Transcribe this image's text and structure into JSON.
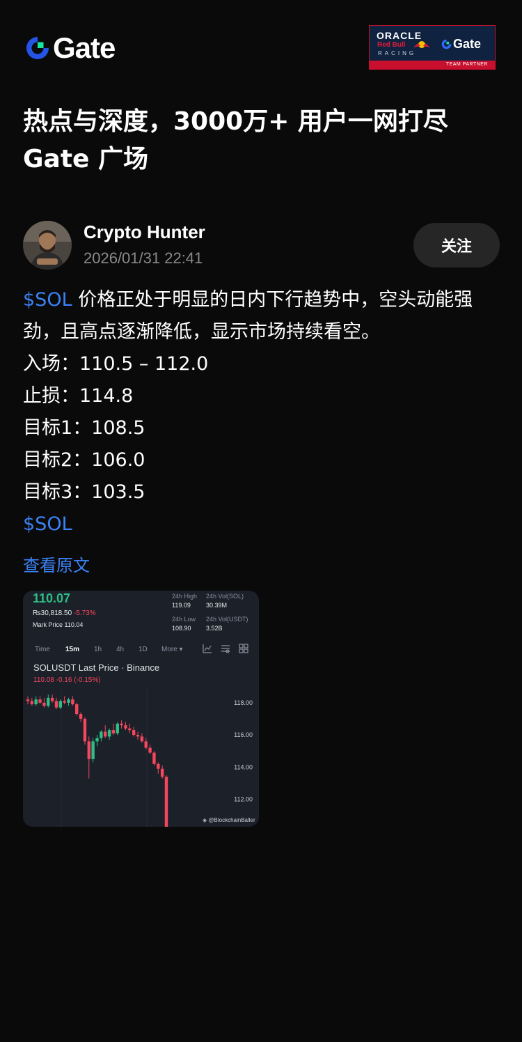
{
  "header": {
    "logo_text": "Gate",
    "partner": {
      "oracle": "ORACLE",
      "redbull": "Red Bull",
      "racing": "RACING",
      "gate": "Gate",
      "label": "TEAM PARTNER"
    }
  },
  "headline": {
    "line1": "热点与深度，3000万+ 用户一网打尽",
    "line2": "Gate 广场"
  },
  "author": {
    "name": "Crypto Hunter",
    "time": "2026/01/31 22:41",
    "follow_label": "关注"
  },
  "post": {
    "tag": "$SOL",
    "intro": " 价格正处于明显的日内下行趋势中，空头动能强劲，且高点逐渐降低，显示市场持续看空。",
    "lines": [
      "入场：110.5 – 112.0",
      "止损：114.8",
      "目标1：108.5",
      "目标2：106.0",
      "目标3：103.5"
    ],
    "tag_end": "$SOL",
    "view_original": "查看原文"
  },
  "trade_card": {
    "price": "110.07",
    "inr": "₨30,818.50",
    "change": "-5.73%",
    "mark_price": "Mark Price 110.04",
    "stats": [
      {
        "label": "24h High",
        "value": "119.09"
      },
      {
        "label": "24h Vol(SOL)",
        "value": "30.39M"
      },
      {
        "label": "24h Low",
        "value": "108.90"
      },
      {
        "label": "24h Vol(USDT)",
        "value": "3.52B"
      }
    ],
    "timeframes": [
      "Time",
      "15m",
      "1h",
      "4h",
      "1D",
      "More ▾"
    ],
    "active_timeframe": "15m",
    "chart_title": "SOLUSDT Last Price · Binance",
    "last_line": "110.08 -0.16 (-0.15%)",
    "watermark": "@BlockchainBaller",
    "colors": {
      "up": "#2ebd85",
      "down": "#f6465d",
      "bg": "#1b2029"
    }
  },
  "chart_data": {
    "type": "candlestick",
    "title": "SOLUSDT Last Price · Binance",
    "y_ticks": [
      "118.00",
      "116.00",
      "114.00",
      "112.00"
    ],
    "ylim": [
      110.3,
      118.9
    ],
    "candles": [
      {
        "o": 118.2,
        "h": 118.4,
        "l": 117.9,
        "c": 118.1
      },
      {
        "o": 118.1,
        "h": 118.3,
        "l": 117.8,
        "c": 117.9
      },
      {
        "o": 117.9,
        "h": 118.4,
        "l": 117.8,
        "c": 118.2
      },
      {
        "o": 118.2,
        "h": 118.4,
        "l": 117.9,
        "c": 118.0
      },
      {
        "o": 118.0,
        "h": 118.3,
        "l": 117.7,
        "c": 117.8
      },
      {
        "o": 117.8,
        "h": 118.5,
        "l": 117.7,
        "c": 118.3
      },
      {
        "o": 118.3,
        "h": 118.5,
        "l": 118.0,
        "c": 118.1
      },
      {
        "o": 118.1,
        "h": 118.3,
        "l": 117.6,
        "c": 117.7
      },
      {
        "o": 117.7,
        "h": 118.2,
        "l": 117.6,
        "c": 118.1
      },
      {
        "o": 118.1,
        "h": 118.4,
        "l": 117.9,
        "c": 118.0
      },
      {
        "o": 118.0,
        "h": 118.3,
        "l": 117.8,
        "c": 118.2
      },
      {
        "o": 118.2,
        "h": 118.4,
        "l": 117.8,
        "c": 117.9
      },
      {
        "o": 117.9,
        "h": 118.0,
        "l": 117.2,
        "c": 117.3
      },
      {
        "o": 117.3,
        "h": 117.4,
        "l": 116.8,
        "c": 117.0
      },
      {
        "o": 117.0,
        "h": 117.1,
        "l": 115.4,
        "c": 115.6
      },
      {
        "o": 115.6,
        "h": 115.9,
        "l": 113.3,
        "c": 114.5
      },
      {
        "o": 114.5,
        "h": 115.8,
        "l": 114.3,
        "c": 115.6
      },
      {
        "o": 115.6,
        "h": 116.0,
        "l": 115.3,
        "c": 115.8
      },
      {
        "o": 115.8,
        "h": 116.3,
        "l": 115.6,
        "c": 116.2
      },
      {
        "o": 116.2,
        "h": 116.6,
        "l": 115.8,
        "c": 115.9
      },
      {
        "o": 115.9,
        "h": 116.4,
        "l": 115.7,
        "c": 116.3
      },
      {
        "o": 116.3,
        "h": 116.7,
        "l": 116.0,
        "c": 116.1
      },
      {
        "o": 116.1,
        "h": 116.8,
        "l": 116.0,
        "c": 116.7
      },
      {
        "o": 116.7,
        "h": 116.9,
        "l": 116.4,
        "c": 116.6
      },
      {
        "o": 116.6,
        "h": 116.8,
        "l": 116.3,
        "c": 116.4
      },
      {
        "o": 116.4,
        "h": 116.7,
        "l": 116.1,
        "c": 116.3
      },
      {
        "o": 116.3,
        "h": 116.5,
        "l": 115.9,
        "c": 116.0
      },
      {
        "o": 116.0,
        "h": 116.2,
        "l": 115.7,
        "c": 115.9
      },
      {
        "o": 115.9,
        "h": 116.1,
        "l": 115.5,
        "c": 115.6
      },
      {
        "o": 115.6,
        "h": 115.8,
        "l": 115.1,
        "c": 115.2
      },
      {
        "o": 115.2,
        "h": 115.4,
        "l": 114.8,
        "c": 114.9
      },
      {
        "o": 114.9,
        "h": 115.0,
        "l": 114.1,
        "c": 114.2
      },
      {
        "o": 114.2,
        "h": 114.3,
        "l": 113.6,
        "c": 113.9
      },
      {
        "o": 113.9,
        "h": 114.1,
        "l": 113.3,
        "c": 113.4
      },
      {
        "o": 113.4,
        "h": 113.5,
        "l": 110.3,
        "c": 110.3
      }
    ]
  }
}
